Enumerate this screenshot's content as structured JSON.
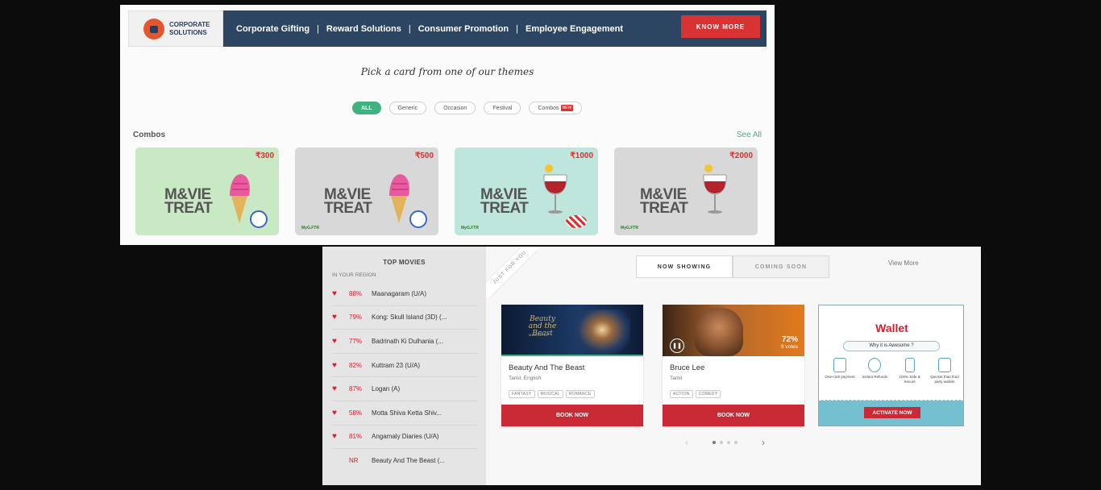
{
  "corporate": {
    "logo_line1": "CORPORATE",
    "logo_line2": "SOLUTIONS",
    "nav": [
      "Corporate Gifting",
      "Reward Solutions",
      "Consumer Promotion",
      "Employee Engagement"
    ],
    "separator": "|",
    "cta": "KNOW MORE"
  },
  "themes": {
    "heading": "Pick a card from one of our themes",
    "filters": [
      "ALL",
      "Generic",
      "Occasion",
      "Festival",
      "Combos"
    ],
    "new_badge": "NEW"
  },
  "combos": {
    "title": "Combos",
    "see_all": "See All",
    "cards": [
      {
        "price": "₹300",
        "line1": "M&VIE",
        "line2": "TREAT",
        "bg": "#c9e8c4"
      },
      {
        "price": "₹500",
        "line1": "M&VIE",
        "line2": "TREAT",
        "bg": "#d8d8d8",
        "partner": "MyG.FTR"
      },
      {
        "price": "₹1000",
        "line1": "M&VIE",
        "line2": "TREAT",
        "bg": "#bfe6dc",
        "partner": "MyG.FTR"
      },
      {
        "price": "₹2000",
        "line1": "M&VIE",
        "line2": "TREAT",
        "bg": "#d8d8d8",
        "partner": "MyG.FTR"
      }
    ]
  },
  "top_movies": {
    "title": "TOP MOVIES",
    "subtitle": "IN YOUR REGION",
    "items": [
      {
        "pct": "88%",
        "name": "Maanagaram (U/A)"
      },
      {
        "pct": "79%",
        "name": "Kong: Skull Island (3D) (..."
      },
      {
        "pct": "77%",
        "name": "Badrinath Ki Dulhania (..."
      },
      {
        "pct": "82%",
        "name": "Kuttram 23 (U/A)"
      },
      {
        "pct": "87%",
        "name": "Logan (A)"
      },
      {
        "pct": "58%",
        "name": "Motta Shiva Ketta Shiv..."
      },
      {
        "pct": "81%",
        "name": "Angamaly Diaries (U/A)"
      },
      {
        "pct": "NR",
        "name": "Beauty And The Beast (..."
      }
    ]
  },
  "ribbon": "JUST FOR YOU",
  "tabs": [
    "NOW SHOWING",
    "COMING SOON"
  ],
  "view_more": "View More",
  "movies": [
    {
      "title": "Beauty And The Beast",
      "lang": "Tamil, English",
      "tags": [
        "FANTASY",
        "MUSICAL",
        "ROMANCE"
      ],
      "cta": "BOOK NOW",
      "poster_title": "Beauty and the Beast",
      "poster_date": "MARCH 17"
    },
    {
      "title": "Bruce Lee",
      "lang": "Tamil",
      "tags": [
        "ACTION",
        "COMEDY"
      ],
      "cta": "BOOK NOW",
      "rating": "72%",
      "votes": "9 votes"
    }
  ],
  "wallet": {
    "title": "Wallet",
    "why": "Why it is Awesome ?",
    "features": [
      "One-click payment",
      "Instant Refunds",
      "100% Safe & Secure",
      "Quicker than third party wallets"
    ],
    "cta": "ACTIVATE NOW"
  },
  "carousel": {
    "prev": "‹",
    "next": "›",
    "active_index": 0,
    "count": 4
  }
}
